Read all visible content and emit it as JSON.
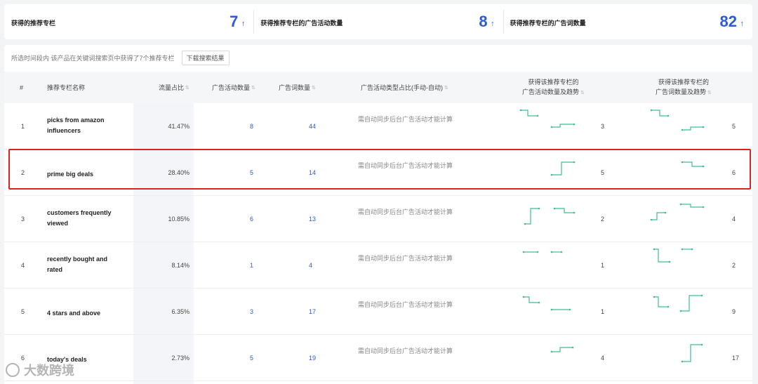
{
  "stats": [
    {
      "label": "获得的推荐专栏",
      "value": "7",
      "arrow": "↑"
    },
    {
      "label": "获得推荐专栏的广告活动数量",
      "value": "8",
      "arrow": "↑"
    },
    {
      "label": "获得推荐专栏的广告词数量",
      "value": "82",
      "arrow": "↑"
    }
  ],
  "toolbar": {
    "text": "所选时间段内 该产品在关键词搜索页中获得了7个推荐专栏",
    "download_label": "下载搜索结果"
  },
  "columns": {
    "idx": "#",
    "name": "推荐专栏名称",
    "share": "流量占比",
    "campaigns": "广告活动数量",
    "keywords": "广告词数量",
    "type": "广告活动类型占比(手动-自动)",
    "camp_trend_l1": "获得该推荐专栏的",
    "camp_trend_l2": "广告活动数量及趋势",
    "kw_trend_l1": "获得该推荐专栏的",
    "kw_trend_l2": "广告词数量及趋势",
    "sort_icon": "⇅"
  },
  "rows": [
    {
      "idx": "1",
      "name": "picks from amazon influencers",
      "share": "41.47%",
      "campaigns": "8",
      "keywords": "44",
      "note": "需自动同步后台广告活动才能计算",
      "trend_campaigns": "3",
      "trend_keywords": "5"
    },
    {
      "idx": "2",
      "name": "prime big deals",
      "share": "28.40%",
      "campaigns": "5",
      "keywords": "14",
      "note": "需自动同步后台广告活动才能计算",
      "trend_campaigns": "5",
      "trend_keywords": "6"
    },
    {
      "idx": "3",
      "name": "customers frequently viewed",
      "share": "10.85%",
      "campaigns": "6",
      "keywords": "13",
      "note": "需自动同步后台广告活动才能计算",
      "trend_campaigns": "2",
      "trend_keywords": "4"
    },
    {
      "idx": "4",
      "name": "recently bought and rated",
      "share": "8.14%",
      "campaigns": "1",
      "keywords": "4",
      "note": "需自动同步后台广告活动才能计算",
      "trend_campaigns": "1",
      "trend_keywords": "2"
    },
    {
      "idx": "5",
      "name": "4 stars and above",
      "share": "6.35%",
      "campaigns": "3",
      "keywords": "17",
      "note": "需自动同步后台广告活动才能计算",
      "trend_campaigns": "1",
      "trend_keywords": "9"
    },
    {
      "idx": "6",
      "name": "today's deals",
      "share": "2.73%",
      "campaigns": "5",
      "keywords": "19",
      "note": "需自动同步后台广告活动才能计算",
      "trend_campaigns": "4",
      "trend_keywords": "17"
    }
  ],
  "watermark": "大数跨境",
  "colors": {
    "accent": "#2d5bd7",
    "spark": "#3fbf8f",
    "highlight": "#e02020"
  }
}
